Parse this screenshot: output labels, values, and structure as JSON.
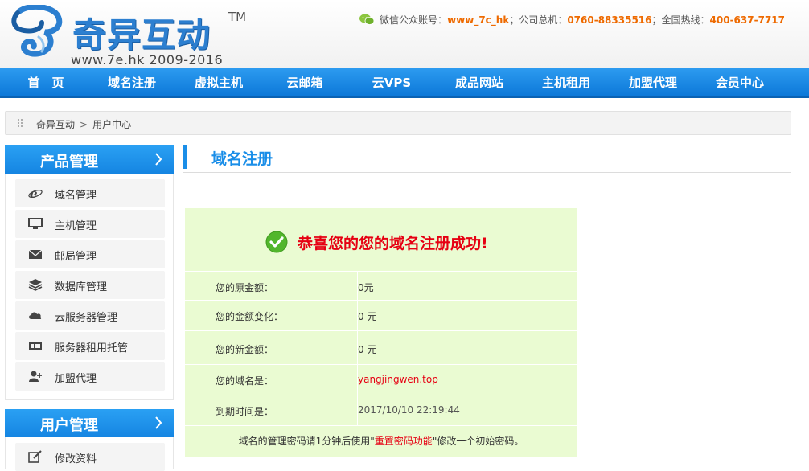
{
  "header": {
    "logo_text": "奇异互动",
    "logo_tm": "TM",
    "logo_sub": "www.7e.hk 2009-2016",
    "contact": {
      "wechat_label": "微信公众账号：",
      "wechat_value": "www_7c_hk",
      "phone_label": "；公司总机：",
      "phone_value": "0760-88335516",
      "hotline_label": "；全国热线：",
      "hotline_value": "400-637-7717"
    }
  },
  "nav": {
    "items": [
      "首　页",
      "域名注册",
      "虚拟主机",
      "云邮箱",
      "云VPS",
      "成品网站",
      "主机租用",
      "加盟代理",
      "会员中心"
    ]
  },
  "breadcrumb": {
    "home": "奇异互动",
    "separator": ">",
    "current": "用户中心"
  },
  "sidebar": {
    "product_title": "产品管理",
    "product_items": [
      {
        "label": "域名管理",
        "icon": "ie-icon"
      },
      {
        "label": "主机管理",
        "icon": "monitor-icon"
      },
      {
        "label": "邮局管理",
        "icon": "mail-icon"
      },
      {
        "label": "数据库管理",
        "icon": "database-icon"
      },
      {
        "label": "云服务器管理",
        "icon": "cloud-icon"
      },
      {
        "label": "服务器租用托管",
        "icon": "server-icon"
      },
      {
        "label": "加盟代理",
        "icon": "add-user-icon"
      }
    ],
    "user_title": "用户管理",
    "user_items": [
      {
        "label": "修改资料",
        "icon": "edit-icon"
      }
    ]
  },
  "main": {
    "title": "域名注册",
    "success_message": "恭喜您的您的域名注册成功!",
    "rows": [
      {
        "key": "您的原金额：",
        "value": "0元"
      },
      {
        "key": "您的金额变化：",
        "value": "0 元"
      },
      {
        "key": "您的新金额：",
        "value": "0 元"
      },
      {
        "key": "您的域名是：",
        "value": "yangjingwen.top"
      },
      {
        "key": "到期时间是：",
        "value": "2017/10/10 22:19:44"
      }
    ],
    "note_before": "域名的管理密码请1分钟后使用\"",
    "note_link": "重置密码功能",
    "note_after": "\"修改一个初始密码。"
  },
  "colors": {
    "brand_blue": "#1a8ee8",
    "highlight_orange": "#ee6a00",
    "success_red": "#e60012",
    "result_bg": "#eafbd2"
  }
}
